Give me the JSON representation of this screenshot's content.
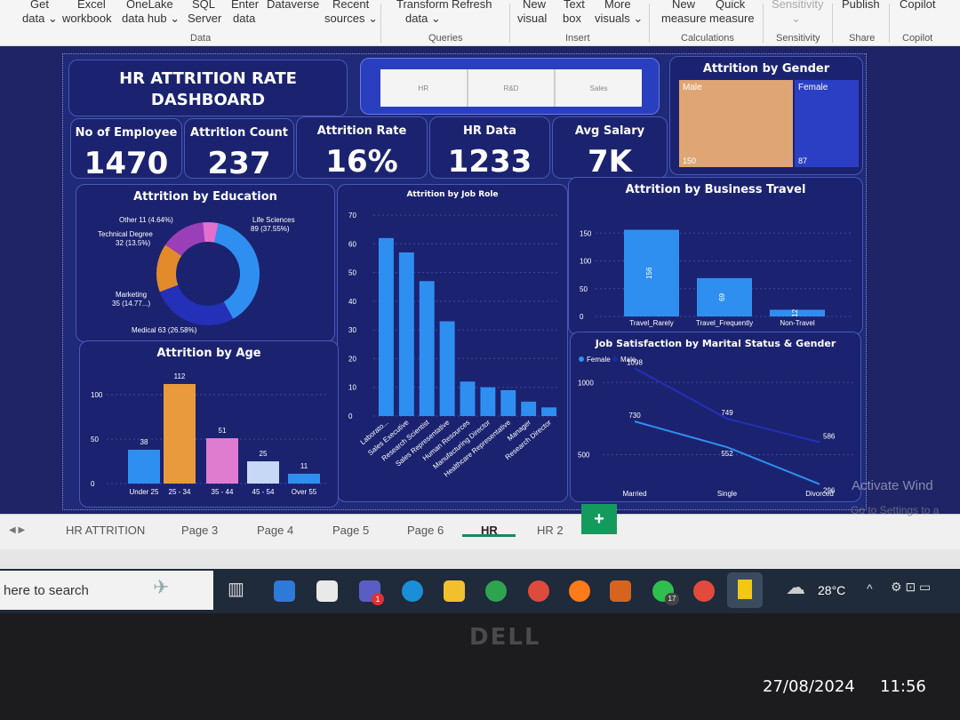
{
  "ribbon": {
    "items_top": [
      "Get",
      "Excel",
      "OneLake",
      "SQL",
      "Enter",
      "Dataverse",
      "Recent",
      "Transform",
      "Refresh",
      "New",
      "Text",
      "More",
      "New",
      "Quick",
      "Sensitivity",
      "Publish",
      "Copilot"
    ],
    "items_bottom": [
      "data ⌄",
      "workbook",
      "data hub ⌄",
      "Server",
      "data",
      "sources ⌄",
      "data ⌄",
      "visual",
      "box",
      "visuals ⌄",
      "measure",
      "measure",
      "⌄"
    ],
    "groups": [
      "Data",
      "Queries",
      "Insert",
      "Calculations",
      "Sensitivity",
      "Share",
      "Copilot"
    ]
  },
  "dashboard": {
    "title": "HR ATTRITION RATE DASHBOARD",
    "slicer": [
      "HR",
      "R&D",
      "Sales"
    ],
    "kpis": [
      {
        "label": "No of Employee",
        "value": "1470"
      },
      {
        "label": "Attrition Count",
        "value": "237"
      },
      {
        "label": "Attrition Rate",
        "value": "16%"
      },
      {
        "label": "HR Data",
        "value": "1233"
      },
      {
        "label": "Avg Salary",
        "value": "7K"
      }
    ],
    "gender": {
      "title": "Attrition by Gender",
      "male_label": "Male",
      "female_label": "Female",
      "male_value": "150",
      "female_value": "87",
      "male_color": "#e0a574",
      "female_color": "#2b3fc4"
    },
    "education": {
      "title": "Attrition by Education",
      "labels": [
        "Other 11 (4.64%)",
        "Technical Degree",
        "32 (13.5%)",
        "Life Sciences",
        "89 (37.55%)",
        "Marketing",
        "35 (14.77...)",
        "Medical 63 (26.58%)"
      ],
      "values": [
        89,
        63,
        35,
        32,
        11
      ],
      "colors": [
        "#2f8ff0",
        "#2430b8",
        "#e38b2a",
        "#9a3fb8",
        "#e36fcf"
      ]
    },
    "jobrole": {
      "title": "Attrition by Job Role",
      "yticks": [
        "70",
        "60",
        "50",
        "40",
        "30",
        "20",
        "10",
        "0"
      ],
      "categories": [
        "Laborato...",
        "Sales Executive",
        "Research Scientist",
        "Sales Representative",
        "Human Resources",
        "Manufacturing Director",
        "Healthcare Representative",
        "Manager",
        "Research Director"
      ],
      "values": [
        62,
        57,
        47,
        33,
        12,
        10,
        9,
        5,
        3
      ]
    },
    "travel": {
      "title": "Attrition by Business Travel",
      "yticks": [
        "150",
        "100",
        "50",
        "0"
      ],
      "categories": [
        "Travel_Rarely",
        "Travel_Frequently",
        "Non-Travel"
      ],
      "values": [
        156,
        69,
        12
      ],
      "labels": [
        "156",
        "69",
        "12"
      ]
    },
    "age": {
      "title": "Attrition by Age",
      "yticks": [
        "100",
        "50",
        "0"
      ],
      "categories": [
        "Under 25",
        "25 - 34",
        "35 - 44",
        "45 - 54",
        "Over 55"
      ],
      "values": [
        38,
        112,
        51,
        25,
        11
      ],
      "labels": [
        "38",
        "112",
        "51",
        "25",
        "11"
      ],
      "colors": [
        "#2f8ff0",
        "#e89a3c",
        "#e07ccf",
        "#c6d8f5",
        "#2f8ff0"
      ]
    },
    "marital": {
      "title": "Job Satisfaction by Marital Status & Gender",
      "legend": [
        "Female",
        "Male"
      ],
      "yticks": [
        "1000",
        "500"
      ],
      "categories": [
        "Married",
        "Single",
        "Divorced"
      ],
      "female": [
        730,
        552,
        296
      ],
      "male": [
        1098,
        749,
        586
      ],
      "female_labels": [
        "730",
        "552",
        "296"
      ],
      "male_labels": [
        "1098",
        "749",
        "586"
      ]
    }
  },
  "tabs": [
    "HR ATTRITION",
    "Page 3",
    "Page 4",
    "Page 5",
    "Page 6",
    "HR",
    "HR 2"
  ],
  "tab_add": "+",
  "watermark": {
    "line1": "Activate Wind",
    "line2": "Go to Settings to a"
  },
  "taskbar": {
    "search": "here to search",
    "temp": "28°C",
    "badge_teams": "1",
    "badge_whatsapp": "17"
  },
  "clock": {
    "date": "27/08/2024",
    "time": "11:56"
  },
  "bezel": {
    "brand": "DELL"
  }
}
